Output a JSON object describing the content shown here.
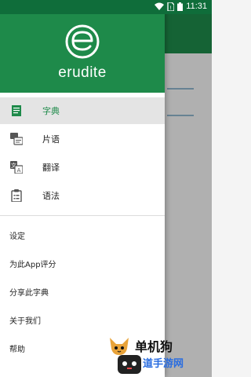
{
  "status_bar": {
    "time": "11:31"
  },
  "drawer": {
    "brand": "erudite",
    "nav": [
      {
        "label": "字典",
        "icon": "dictionary-icon",
        "selected": true
      },
      {
        "label": "片语",
        "icon": "phrases-icon",
        "selected": false
      },
      {
        "label": "翻译",
        "icon": "translate-icon",
        "selected": false
      },
      {
        "label": "语法",
        "icon": "grammar-icon",
        "selected": false
      }
    ],
    "menu": [
      "设定",
      "为此App评分",
      "分享此字典",
      "关于我们",
      "帮助"
    ]
  },
  "watermark": {
    "line1": "单机狗",
    "line2": "道手游网"
  },
  "colors": {
    "primary": "#1e8a4a",
    "status_bar": "#0f6d3a",
    "selected_bg": "#e4e4e4"
  }
}
